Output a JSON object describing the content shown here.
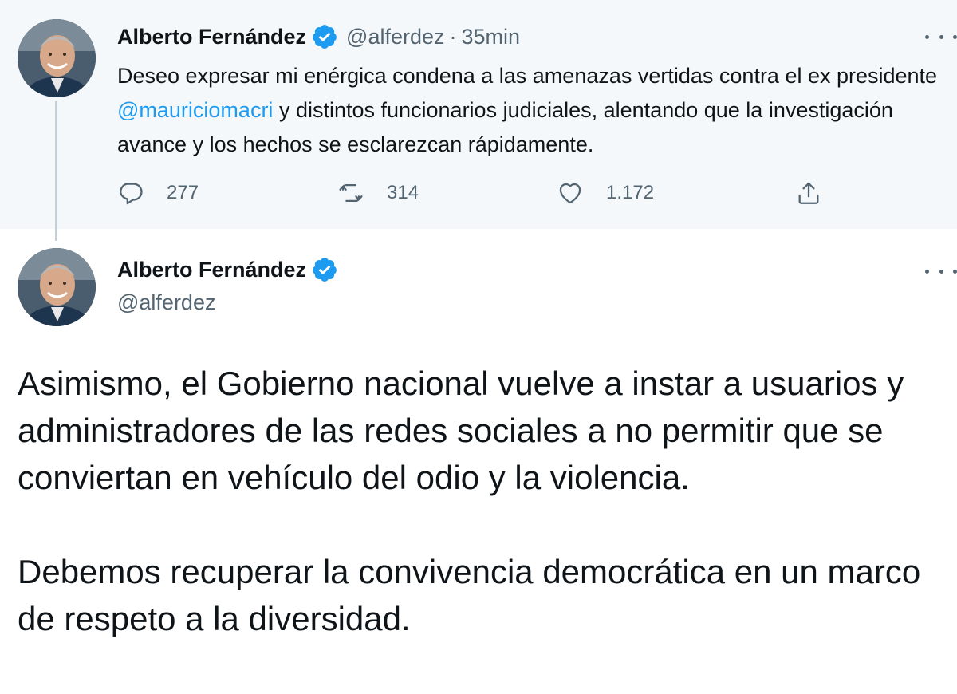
{
  "tweet_top": {
    "display_name": "Alberto Fernández",
    "handle": "@alferdez",
    "separator": "·",
    "timestamp": "35min",
    "text_before_mention": "Deseo expresar mi enérgica condena a las amenazas vertidas contra el ex presidente ",
    "mention": "@mauriciomacri",
    "text_after_mention": " y distintos funcionarios judiciales, alentando que la investigación avance y los hechos se esclarezcan rápidamente.",
    "actions": {
      "reply_icon": "reply-icon",
      "reply_count": "277",
      "retweet_icon": "retweet-icon",
      "retweet_count": "314",
      "like_icon": "heart-icon",
      "like_count": "1.172",
      "share_icon": "share-icon"
    },
    "background": "#f5f8fa"
  },
  "tweet_main": {
    "display_name": "Alberto Fernández",
    "handle": "@alferdez",
    "paragraph_1": "Asimismo, el Gobierno nacional vuelve a instar a usuarios y administradores de las redes sociales a no permitir que se conviertan en vehículo del odio y la violencia.",
    "paragraph_2": "Debemos recuperar la convivencia democrática en un marco de respeto a la diversidad."
  },
  "colors": {
    "accent": "#1d9bf0",
    "text": "#0f1419",
    "secondary": "#536471",
    "thread_line": "#c4cfd6"
  }
}
